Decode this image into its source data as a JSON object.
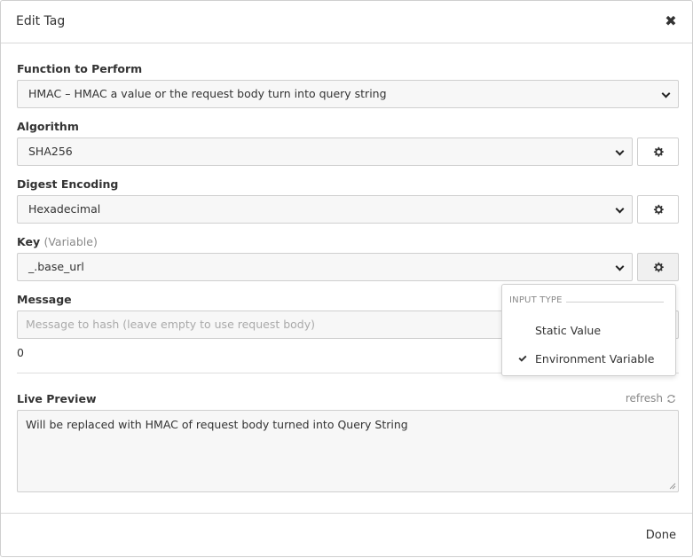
{
  "modal": {
    "title": "Edit Tag",
    "done_label": "Done"
  },
  "function": {
    "label": "Function to Perform",
    "selected": "HMAC – HMAC a value or the request body turn into query string"
  },
  "algorithm": {
    "label": "Algorithm",
    "selected": "SHA256"
  },
  "digest": {
    "label": "Digest Encoding",
    "selected": "Hexadecimal"
  },
  "key": {
    "label": "Key",
    "hint": "(Variable)",
    "selected": "_.base_url"
  },
  "message": {
    "label": "Message",
    "placeholder": "Message to hash (leave empty to use request body)",
    "count": "0"
  },
  "preview": {
    "label": "Live Preview",
    "refresh_label": "refresh",
    "text": "Will be replaced with HMAC of request body turned into Query String"
  },
  "input_type_menu": {
    "header": "INPUT TYPE",
    "items": [
      {
        "label": "Static Value",
        "checked": false
      },
      {
        "label": "Environment Variable",
        "checked": true
      }
    ]
  }
}
